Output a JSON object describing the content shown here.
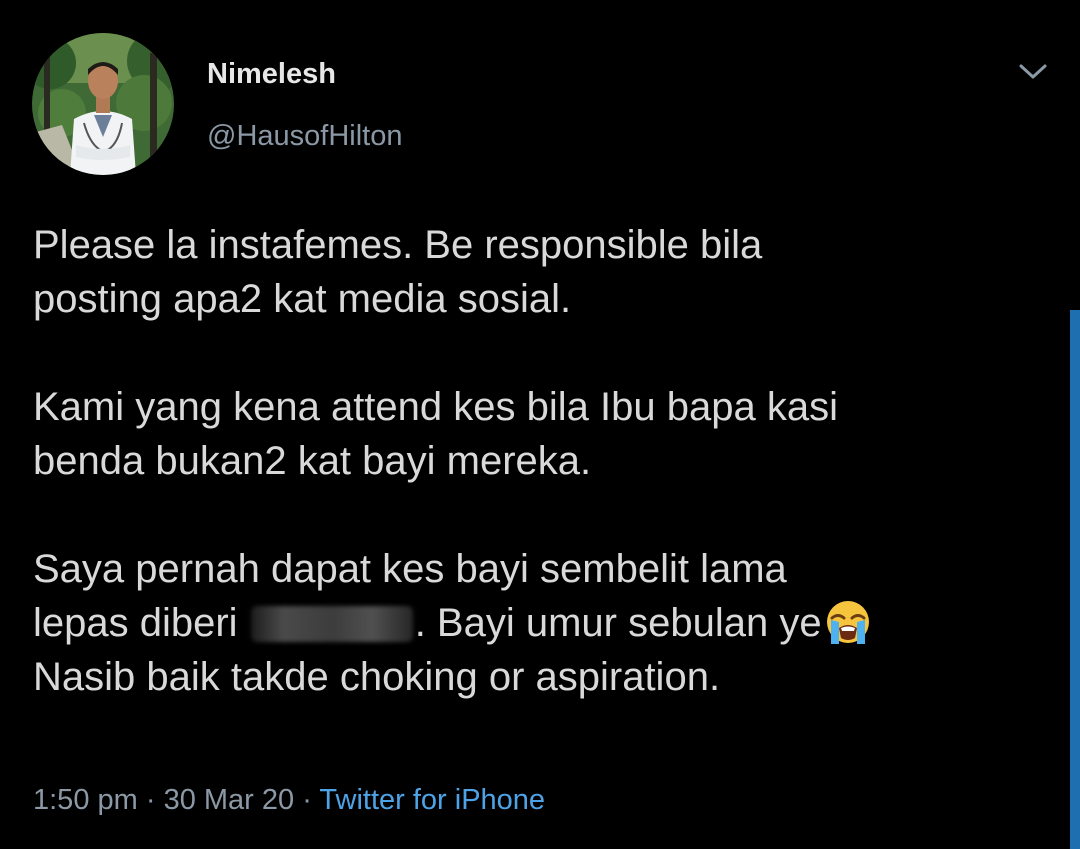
{
  "tweet": {
    "author": {
      "display_name": "Nimelesh",
      "handle": "@HausofHilton",
      "avatar_icon": "doctor-photo-avatar"
    },
    "more_icon": "chevron-down-icon",
    "paragraph1": {
      "line1": "Please la instafemes. Be responsible bila",
      "line2": "posting apa2 kat media sosial."
    },
    "paragraph2": {
      "line1": "Kami yang kena attend kes bila Ibu bapa kasi",
      "line2": "benda bukan2 kat bayi mereka."
    },
    "paragraph3": {
      "line1": "Saya pernah dapat kes bayi sembelit lama",
      "line2_before": "lepas diberi",
      "line2_after": ". Bayi umur sebulan ye",
      "line2_emoji": "loudly-crying-face-emoji",
      "line3": "Nasib baik takde choking or aspiration."
    },
    "meta": {
      "time": "1:50 pm",
      "separator": " · ",
      "date": "30 Mar 20",
      "source": "Twitter for iPhone"
    }
  },
  "colors": {
    "background": "#000000",
    "text": "#d9d9d9",
    "secondary": "#8b98a5",
    "link": "#4ea3e6",
    "scrollbar": "#1d6fb0"
  }
}
